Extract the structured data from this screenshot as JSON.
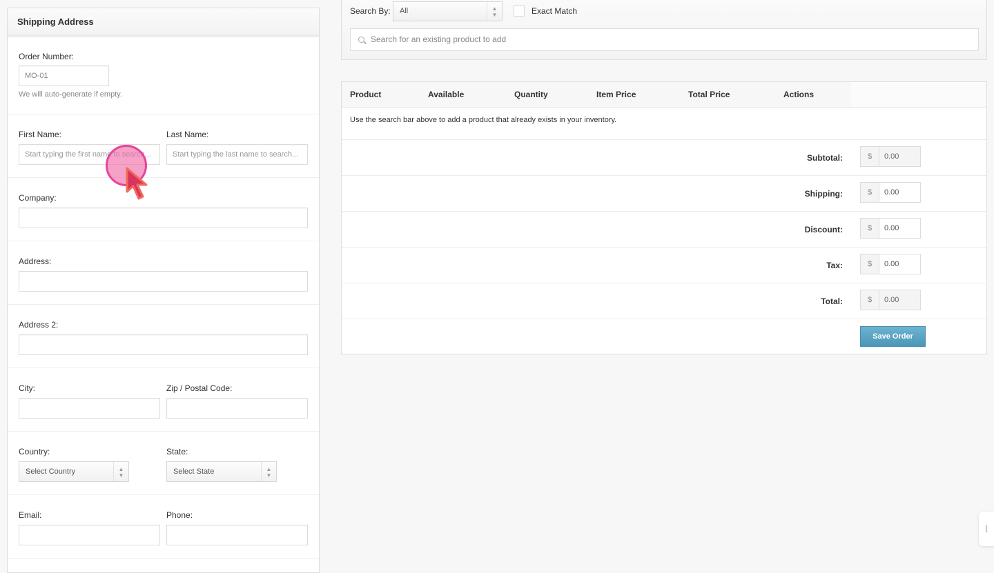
{
  "shipping": {
    "title": "Shipping Address",
    "order_number": {
      "label": "Order Number:",
      "value": "MO-01",
      "help": "We will auto-generate if empty."
    },
    "first_name": {
      "label": "First Name:",
      "placeholder": "Start typing the first name to search..."
    },
    "last_name": {
      "label": "Last Name:",
      "placeholder": "Start typing the last name to search..."
    },
    "company": {
      "label": "Company:",
      "value": ""
    },
    "address": {
      "label": "Address:",
      "value": ""
    },
    "address2": {
      "label": "Address 2:",
      "value": ""
    },
    "city": {
      "label": "City:",
      "value": ""
    },
    "zip": {
      "label": "Zip / Postal Code:",
      "value": ""
    },
    "country": {
      "label": "Country:",
      "selected": "Select Country"
    },
    "state": {
      "label": "State:",
      "selected": "Select State"
    },
    "email": {
      "label": "Email:",
      "value": ""
    },
    "phone": {
      "label": "Phone:",
      "value": ""
    }
  },
  "search": {
    "search_by_label": "Search By:",
    "search_by_selected": "All",
    "exact_match_label": "Exact Match",
    "exact_match_checked": false,
    "product_placeholder": "Search for an existing product to add"
  },
  "order_table": {
    "columns": [
      "Product",
      "Available",
      "Quantity",
      "Item Price",
      "Total Price",
      "Actions"
    ],
    "empty_message": "Use the search bar above to add a product that already exists in your inventory.",
    "totals": [
      {
        "label": "Subtotal:",
        "currency": "$",
        "value": "0.00",
        "readonly": true
      },
      {
        "label": "Shipping:",
        "currency": "$",
        "value": "0.00",
        "readonly": false
      },
      {
        "label": "Discount:",
        "currency": "$",
        "value": "0.00",
        "readonly": false
      },
      {
        "label": "Tax:",
        "currency": "$",
        "value": "0.00",
        "readonly": false
      },
      {
        "label": "Total:",
        "currency": "$",
        "value": "0.00",
        "readonly": true
      }
    ],
    "save_label": "Save Order"
  },
  "widget": {
    "icon": "⌇"
  },
  "colors": {
    "save_button": "#5aa5c6",
    "cursor": "#e6449a"
  }
}
